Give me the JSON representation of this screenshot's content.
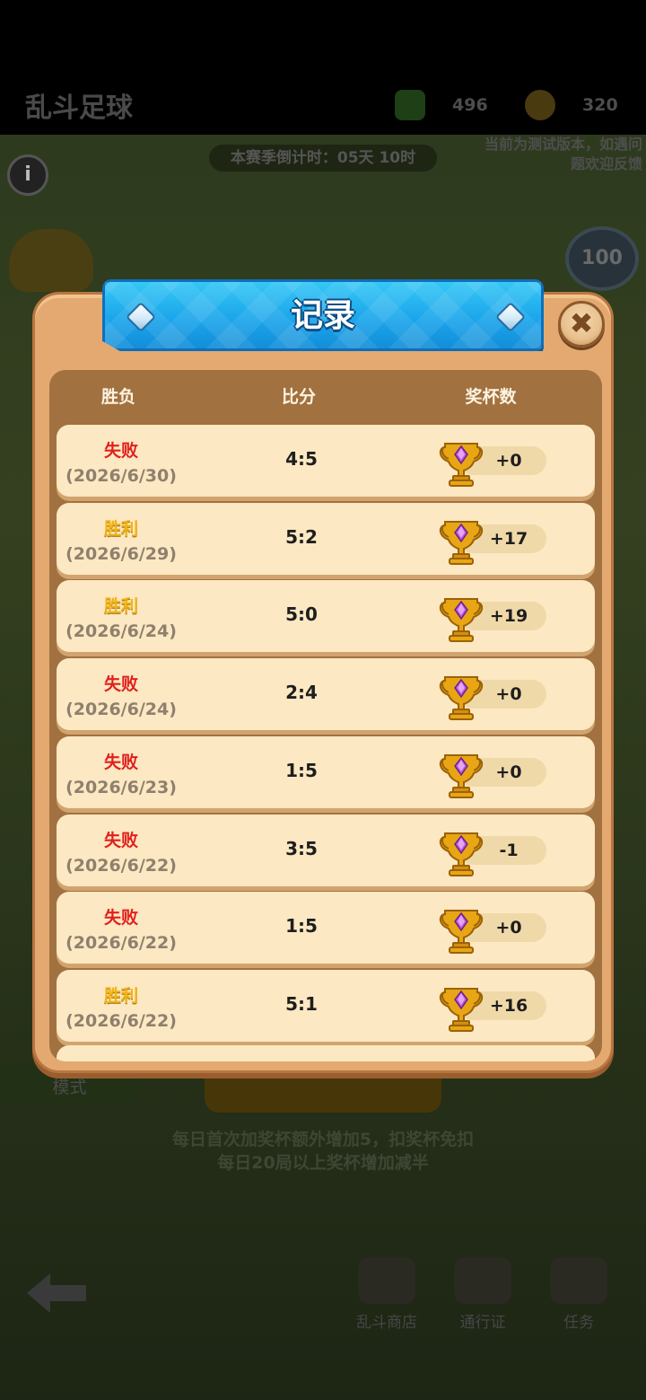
{
  "background": {
    "title": "乱斗足球",
    "cubes": "496",
    "tokens": "320",
    "countdown": "本赛季倒计时：05天 10时",
    "notice": "当前为测试版本，如遇问题欢迎反馈",
    "badge": "100",
    "mode_label": "模式",
    "hint_line1": "每日首次加奖杯额外增加5，扣奖杯免扣",
    "hint_line2": "每日20局以上奖杯增加减半",
    "nav": [
      {
        "label": "乱斗商店"
      },
      {
        "label": "通行证"
      },
      {
        "label": "任务"
      }
    ]
  },
  "modal": {
    "title": "记录",
    "close_symbol": "✖",
    "headers": {
      "result": "胜负",
      "score": "比分",
      "trophies": "奖杯数"
    },
    "records": [
      {
        "result": "失败",
        "outcome": "lose",
        "date": "(2026/6/30)",
        "score": "4:5",
        "trophies": "+0"
      },
      {
        "result": "胜利",
        "outcome": "win",
        "date": "(2026/6/29)",
        "score": "5:2",
        "trophies": "+17"
      },
      {
        "result": "胜利",
        "outcome": "win",
        "date": "(2026/6/24)",
        "score": "5:0",
        "trophies": "+19"
      },
      {
        "result": "失败",
        "outcome": "lose",
        "date": "(2026/6/24)",
        "score": "2:4",
        "trophies": "+0"
      },
      {
        "result": "失败",
        "outcome": "lose",
        "date": "(2026/6/23)",
        "score": "1:5",
        "trophies": "+0"
      },
      {
        "result": "失败",
        "outcome": "lose",
        "date": "(2026/6/22)",
        "score": "3:5",
        "trophies": "-1"
      },
      {
        "result": "失败",
        "outcome": "lose",
        "date": "(2026/6/22)",
        "score": "1:5",
        "trophies": "+0"
      },
      {
        "result": "胜利",
        "outcome": "win",
        "date": "(2026/6/22)",
        "score": "5:1",
        "trophies": "+16"
      }
    ]
  },
  "colors": {
    "lose": "#e0201d",
    "win": "#f2b416",
    "banner": "#1aa3ea",
    "panel": "#e4a971"
  }
}
